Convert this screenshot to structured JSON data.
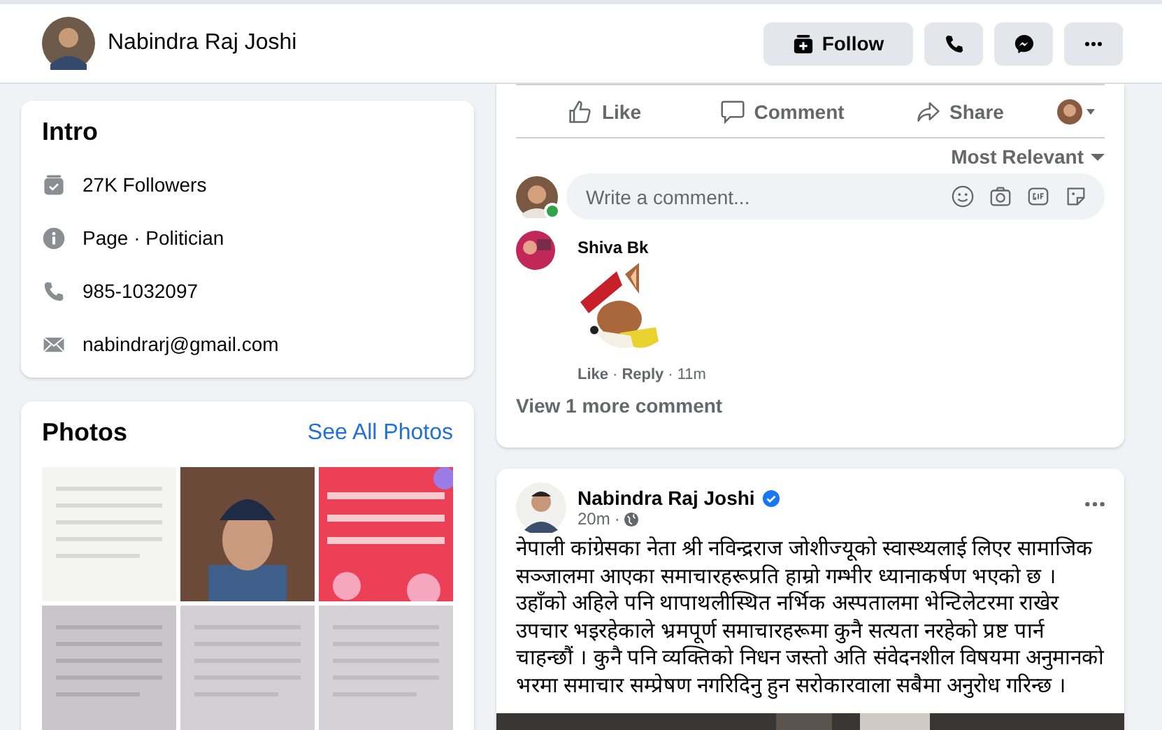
{
  "header": {
    "name": "Nabindra Raj Joshi",
    "buttons": [
      {
        "kind": "follow",
        "label": "Follow"
      },
      {
        "kind": "call"
      },
      {
        "kind": "messenger"
      },
      {
        "kind": "more"
      }
    ]
  },
  "intro": {
    "title": "Intro",
    "items": [
      {
        "kind": "followers",
        "text": "27K Followers"
      },
      {
        "kind": "info",
        "text": "Page · Politician"
      },
      {
        "kind": "phone",
        "text": "985-1032097"
      },
      {
        "kind": "email",
        "text": "nabindrarj@gmail.com"
      }
    ]
  },
  "photos": {
    "title": "Photos",
    "link": "See All Photos"
  },
  "post_actions": [
    {
      "kind": "like",
      "label": "Like"
    },
    {
      "kind": "comment",
      "label": "Comment"
    },
    {
      "kind": "share",
      "label": "Share"
    }
  ],
  "sort": "Most Relevant",
  "comment_box": {
    "placeholder": "Write a comment...",
    "online": true
  },
  "comments": [
    {
      "author": "Shiva Bk",
      "like": "Like",
      "sep1": "·",
      "reply": "Reply",
      "sep2": "·",
      "time": "11m"
    }
  ],
  "view_more": "View 1 more comment",
  "post": {
    "author": "Nabindra Raj Joshi",
    "verified": true,
    "time": "20m",
    "sep": "·",
    "text": "नेपाली कांग्रेसका नेता श्री नविन्द्रराज जोशीज्यूको स्वास्थ्यलाई लिएर सामाजिक सञ्जालमा आएका समाचारहरूप्रति हाम्रो गम्भीर ध्यानाकर्षण भएको छ । उहाँको अहिले पनि थापाथलीस्थित नर्भिक अस्पतालमा भेन्टिलेटरमा राखेर उपचार भइरहेकाले भ्रमपूर्ण समाचारहरूमा कुनै सत्यता नरहेको प्रष्ट पार्न चाहन्छौं । कुनै पनि व्यक्तिको निधन जस्तो अति संवेदनशील विषयमा अनुमानको भरमा समाचार सम्प्रेषण नगरिदिनु हुन सरोकारवाला सबैमा अनुरोध गरिन्छ ।"
  }
}
